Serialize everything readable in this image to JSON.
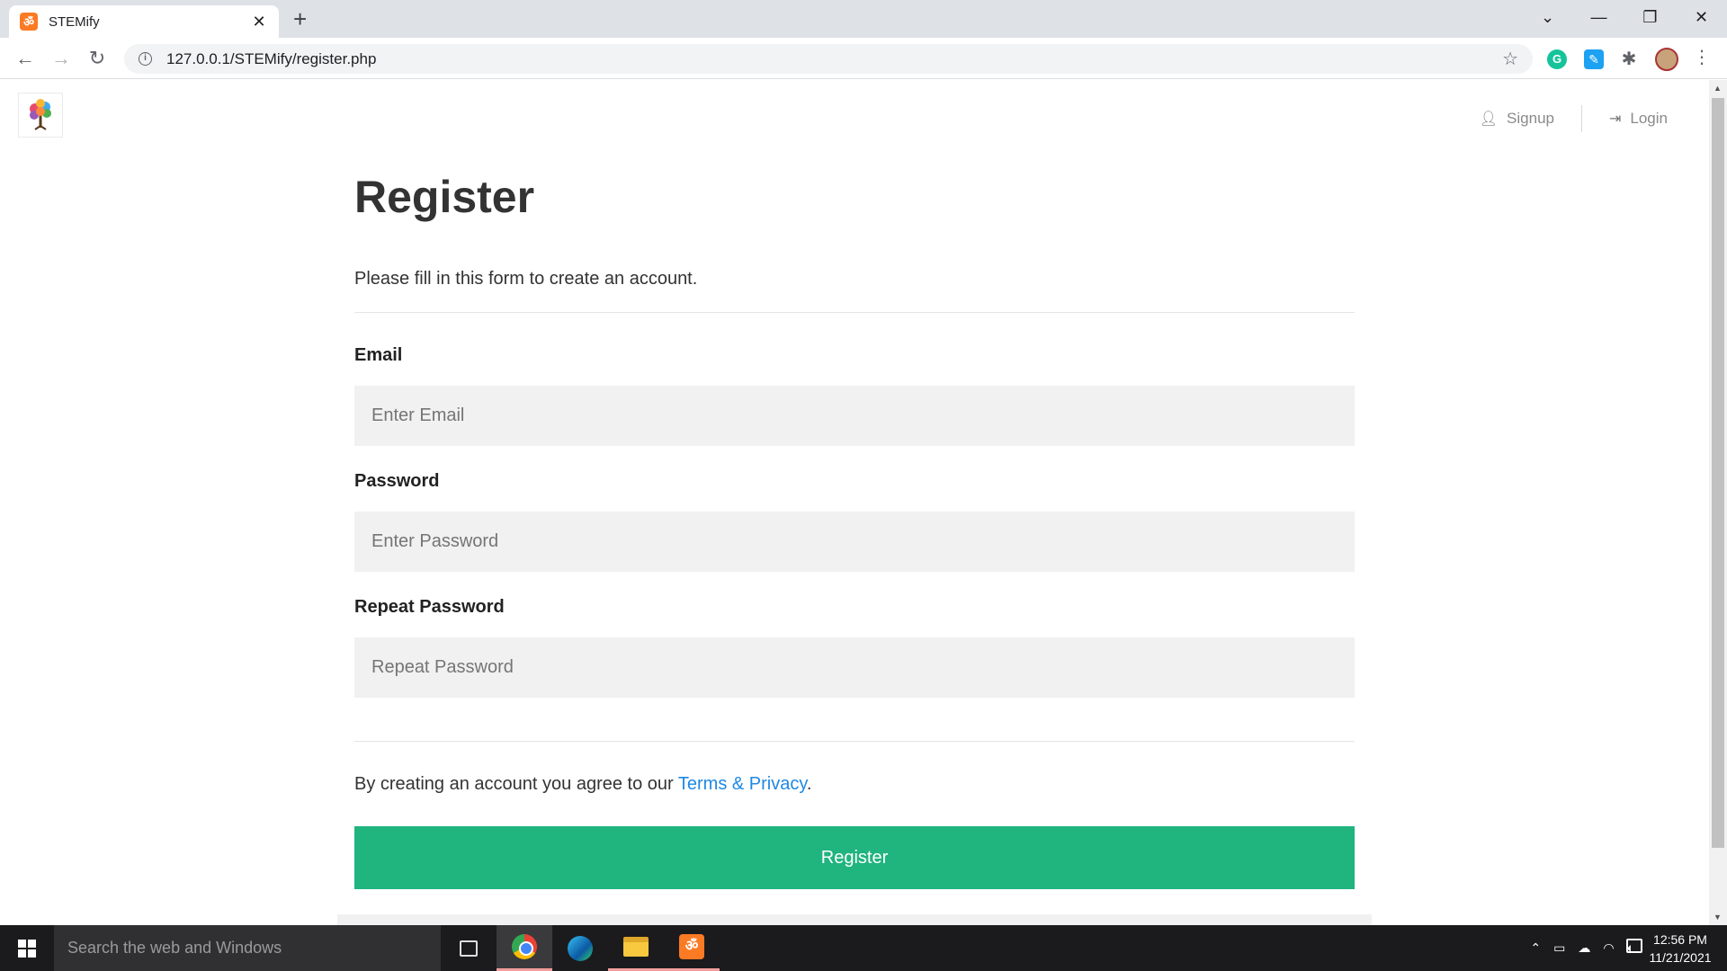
{
  "browser": {
    "tab_title": "STEMify",
    "tab_close": "✕",
    "new_tab": "+",
    "url": "127.0.0.1/STEMify/register.php",
    "window_controls": [
      "⌄",
      "—",
      "❐",
      "✕"
    ]
  },
  "site": {
    "nav": {
      "signup_label": "Signup",
      "login_label": "Login"
    }
  },
  "form": {
    "title": "Register",
    "subtitle": "Please fill in this form to create an account.",
    "email_label": "Email",
    "email_placeholder": "Enter Email",
    "password_label": "Password",
    "password_placeholder": "Enter Password",
    "repeat_label": "Repeat Password",
    "repeat_placeholder": "Repeat Password",
    "terms_prefix": "By creating an account you agree to our ",
    "terms_link": "Terms & Privacy",
    "terms_suffix": ".",
    "register_button": "Register"
  },
  "taskbar": {
    "search_placeholder": "Search the web and Windows",
    "time": "12:56 PM",
    "date": "11/21/2021"
  },
  "colors": {
    "accent_green": "#20b47e",
    "link_blue": "#1e88e5",
    "input_bg": "#f1f1f1"
  }
}
